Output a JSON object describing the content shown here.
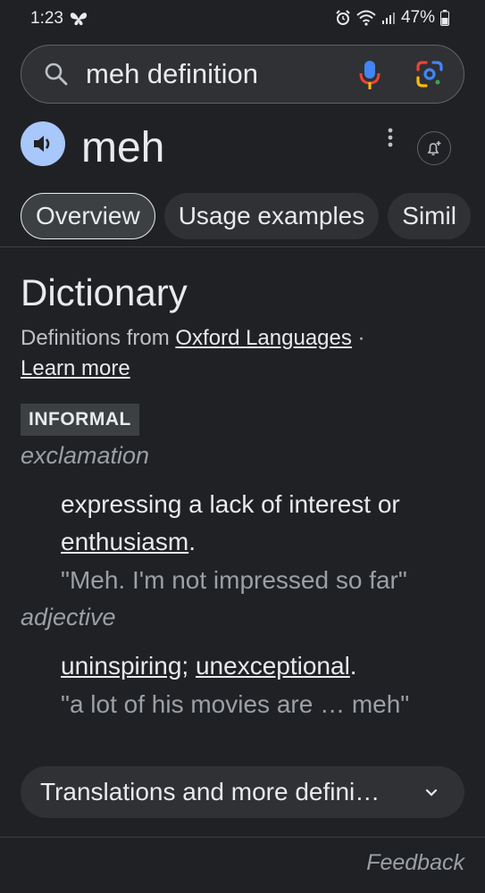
{
  "status": {
    "time": "1:23",
    "battery": "47%"
  },
  "search": {
    "query": "meh definition"
  },
  "header": {
    "word": "meh"
  },
  "tabs": [
    {
      "label": "Overview"
    },
    {
      "label": "Usage examples"
    },
    {
      "label": "Simil"
    }
  ],
  "dictionary": {
    "title": "Dictionary",
    "source_prefix": "Definitions from ",
    "source_link": "Oxford Languages",
    "separator": " ·",
    "learn_more": "Learn more",
    "badge": "INFORMAL",
    "entries": [
      {
        "pos": "exclamation",
        "def_text": "expressing a lack of interest or ",
        "def_link": "enthusiasm",
        "def_end": ".",
        "example": "\"Meh. I'm not impressed so far\""
      },
      {
        "pos": "adjective",
        "def_link1": "uninspiring",
        "def_sep": "; ",
        "def_link2": "unexceptional",
        "def_end": ".",
        "example": "\"a lot of his movies are … meh\""
      }
    ]
  },
  "translations": {
    "label": "Translations and more defini…"
  },
  "feedback": "Feedback"
}
